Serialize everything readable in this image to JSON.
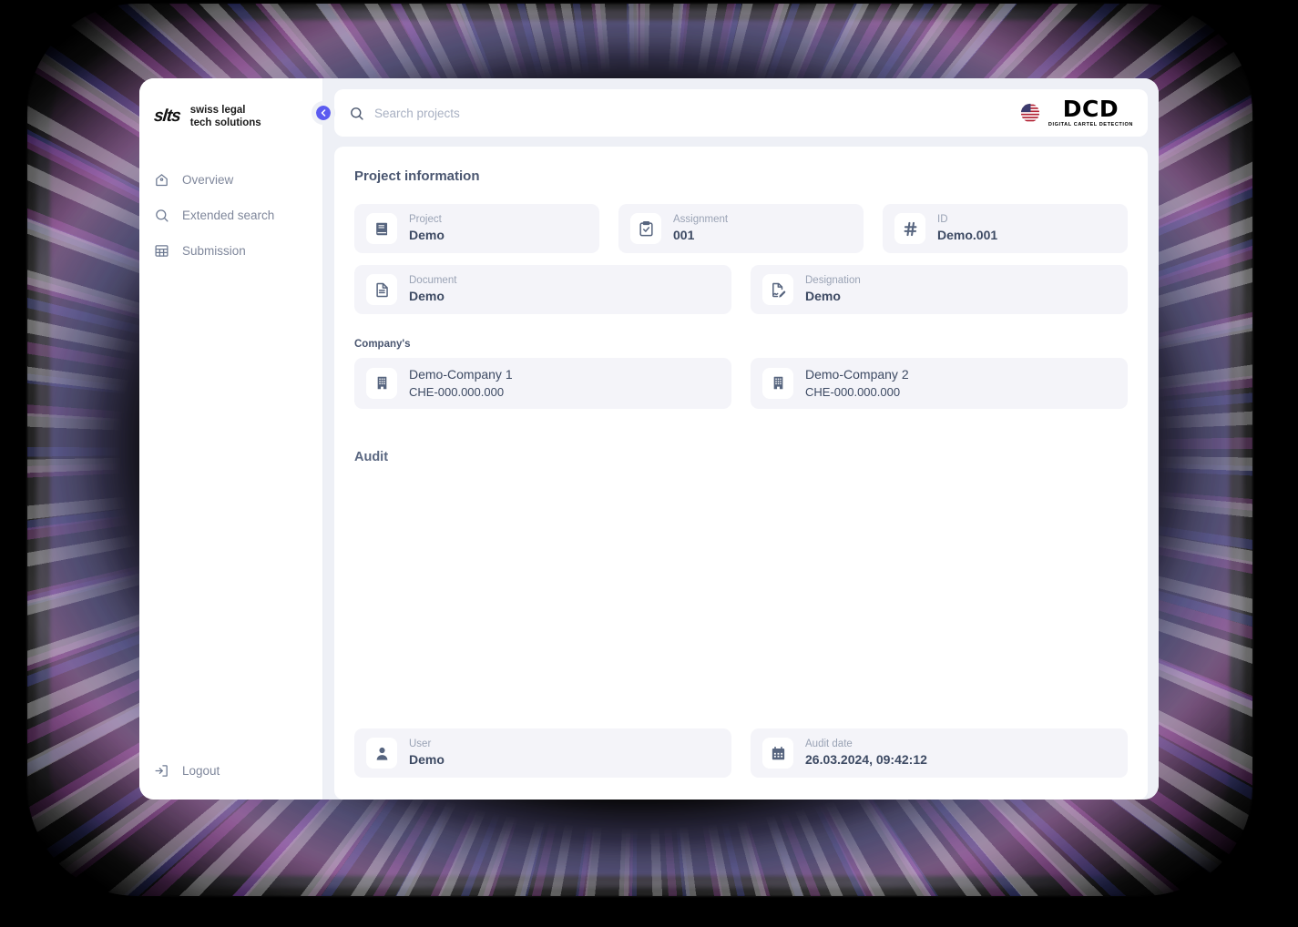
{
  "brand": {
    "mark": "slts",
    "line1": "swiss legal",
    "line2": "tech solutions"
  },
  "sidebar": {
    "items": [
      {
        "label": "Overview",
        "icon": "home-icon"
      },
      {
        "label": "Extended search",
        "icon": "search-icon"
      },
      {
        "label": "Submission",
        "icon": "grid-icon"
      }
    ],
    "logout_label": "Logout",
    "collapse_icon": "chevron-left-icon",
    "accent_color": "#5b5bf0"
  },
  "topbar": {
    "search_placeholder": "Search projects",
    "search_value": "",
    "search_icon": "search-icon",
    "logo": {
      "flag_icon": "us-flag-icon",
      "title": "DCD",
      "subtitle": "DIGITAL CARTEL DETECTION"
    }
  },
  "panel": {
    "title": "Project information",
    "fields_row1": [
      {
        "label": "Project",
        "value": "Demo",
        "icon": "book-icon"
      },
      {
        "label": "Assignment",
        "value": "001",
        "icon": "clipboard-check-icon"
      },
      {
        "label": "ID",
        "value": "Demo.001",
        "icon": "hash-icon"
      }
    ],
    "fields_row2": [
      {
        "label": "Document",
        "value": "Demo",
        "icon": "file-text-icon"
      },
      {
        "label": "Designation",
        "value": "Demo",
        "icon": "signature-icon"
      }
    ],
    "companies_label": "Company's",
    "companies": [
      {
        "name": "Demo-Company 1",
        "number": "CHE-000.000.000",
        "icon": "building-icon"
      },
      {
        "name": "Demo-Company 2",
        "number": "CHE-000.000.000",
        "icon": "building-icon"
      }
    ],
    "audit_heading": "Audit",
    "audit_fields": [
      {
        "label": "User",
        "value": "Demo",
        "icon": "user-icon"
      },
      {
        "label": "Audit date",
        "value": "26.03.2024, 09:42:12",
        "icon": "calendar-icon"
      }
    ]
  },
  "colors": {
    "accent": "#5b5bf0",
    "page_bg": "#eef0f6",
    "card_bg": "#f4f4f9",
    "text_dark": "#3d4a63",
    "text_muted": "#9aa3b5"
  }
}
